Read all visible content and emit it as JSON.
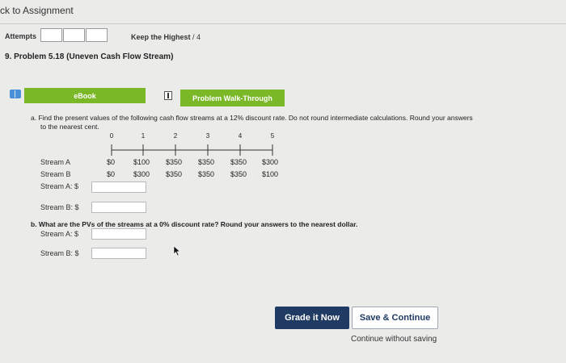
{
  "nav": {
    "back_link": "ck to Assignment"
  },
  "attempts": {
    "label": "Attempts",
    "keep_label": "Keep the Highest",
    "keep_value": "/ 4"
  },
  "problem": {
    "title": "9. Problem 5.18 (Uneven Cash Flow Stream)"
  },
  "buttons": {
    "ebook": "eBook",
    "walkthrough": "Problem Walk-Through",
    "grade": "Grade it Now",
    "save": "Save & Continue",
    "continue_without": "Continue without saving"
  },
  "part_a": {
    "line1": "a. Find the present values of the following cash flow streams at a 12% discount rate. Do not round intermediate calculations. Round your answers",
    "line2": "to the nearest cent."
  },
  "timeline": {
    "periods": [
      "0",
      "1",
      "2",
      "3",
      "4",
      "5"
    ],
    "rows": [
      {
        "label": "Stream A",
        "values": [
          "$0",
          "$100",
          "$350",
          "$350",
          "$350",
          "$300"
        ]
      },
      {
        "label": "Stream B",
        "values": [
          "$0",
          "$300",
          "$350",
          "$350",
          "$350",
          "$100"
        ]
      }
    ]
  },
  "answers_a": {
    "stream_a_label": "Stream A: $",
    "stream_b_label": "Stream B: $"
  },
  "part_b": {
    "question": "b. What are the PVs of the streams at a 0% discount rate? Round your answers to the nearest dollar."
  },
  "answers_b": {
    "stream_a_label": "Stream A: $",
    "stream_b_label": "Stream B: $"
  },
  "colors": {
    "green": "#7ab828",
    "navy": "#1f3a63",
    "background": "#ebebea"
  }
}
